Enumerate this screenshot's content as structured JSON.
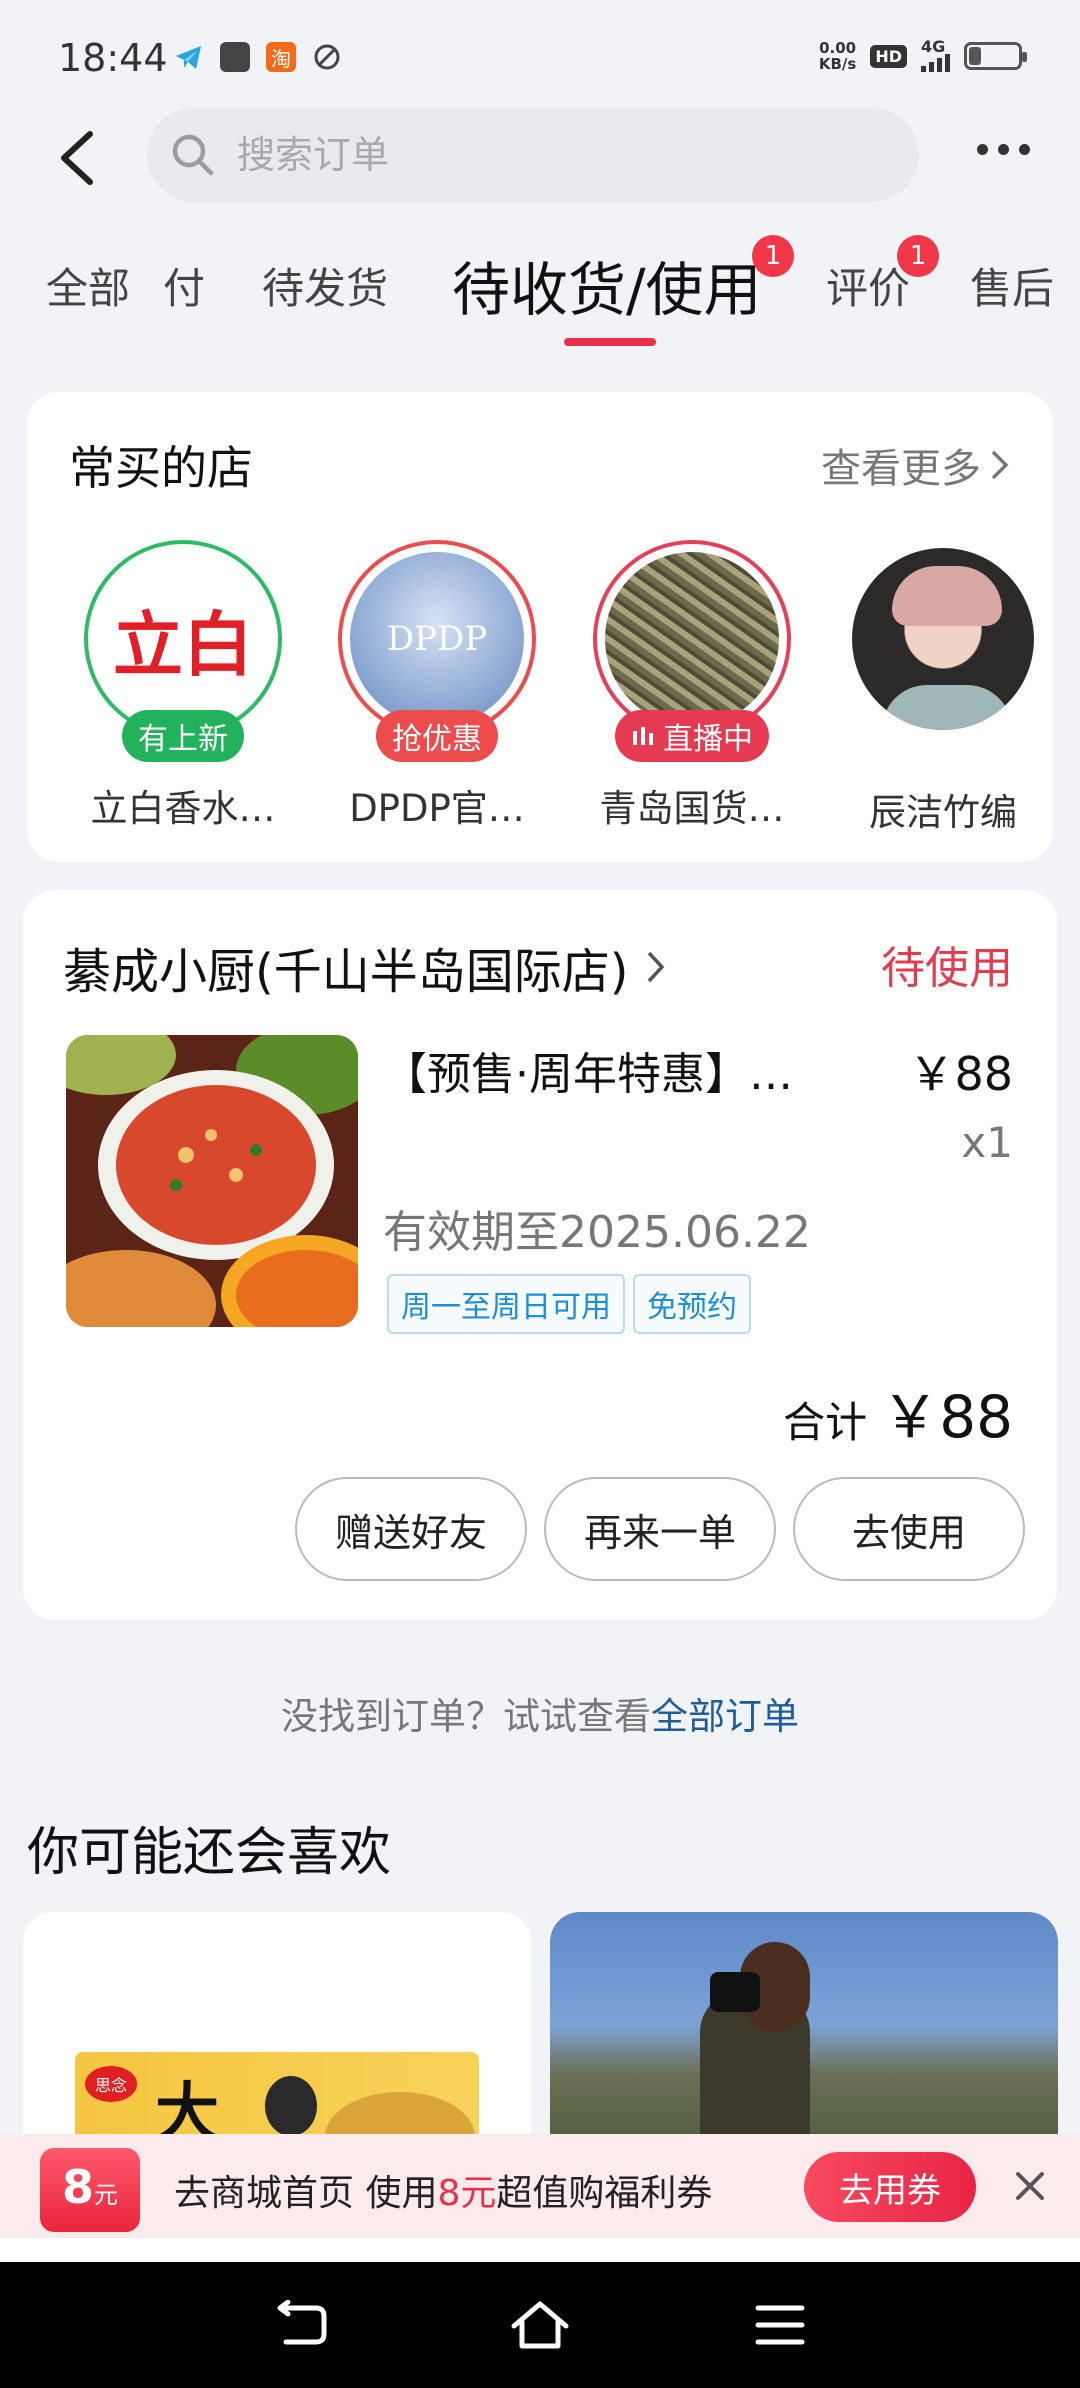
{
  "status_bar": {
    "time": "18:44",
    "net_speed_value": "0.00",
    "net_speed_unit": "KB/s",
    "hd": "HD",
    "network": "4G",
    "app_icons": [
      "telegram-icon",
      "square-app-icon",
      "taobao-icon",
      "leaf-icon"
    ],
    "app_icon_glyph_taobao": "淘"
  },
  "header": {
    "search_placeholder": "搜索订单"
  },
  "tabs": {
    "items": [
      {
        "label": "全部"
      },
      {
        "label": "付"
      },
      {
        "label": "待发货"
      },
      {
        "label": "待收货/使用",
        "active": true,
        "badge": "1"
      },
      {
        "label": "评价",
        "badge": "1"
      },
      {
        "label": "售后"
      }
    ]
  },
  "frequent_stores": {
    "title": "常买的店",
    "see_more": "查看更多",
    "stores": [
      {
        "name": "立白香水…",
        "tag": "有上新",
        "logo_text": "立白"
      },
      {
        "name": "DPDP官…",
        "tag": "抢优惠",
        "logo_text": "DPDP"
      },
      {
        "name": "青岛国货…",
        "tag": "直播中"
      },
      {
        "name": "辰洁竹编"
      }
    ]
  },
  "order": {
    "shop_name": "綦成小厨(千山半岛国际店)",
    "status": "待使用",
    "product_title": "【预售·周年特惠】…",
    "price": "￥88",
    "quantity": "x1",
    "expiry": "有效期至2025.06.22",
    "tags": [
      "周一至周日可用",
      "免预约"
    ],
    "total_label": "合计",
    "total_amount": "￥88",
    "buttons": {
      "gift": "赠送好友",
      "reorder": "再来一单",
      "use": "去使用"
    }
  },
  "hint": {
    "text": "没找到订单？试试查看",
    "link": "全部订单"
  },
  "recommend": {
    "title": "你可能还会喜欢",
    "product_brand": "思念",
    "product_text": "大"
  },
  "coupon": {
    "badge_value": "8",
    "badge_unit": "元",
    "text_before": "去商城首页 使用",
    "text_amount": "8元",
    "text_after": "超值购福利券",
    "button": "去用券"
  },
  "colors": {
    "accent": "#e8304a",
    "link": "#1f5c9a",
    "tag_blue": "#1c8ed8"
  }
}
